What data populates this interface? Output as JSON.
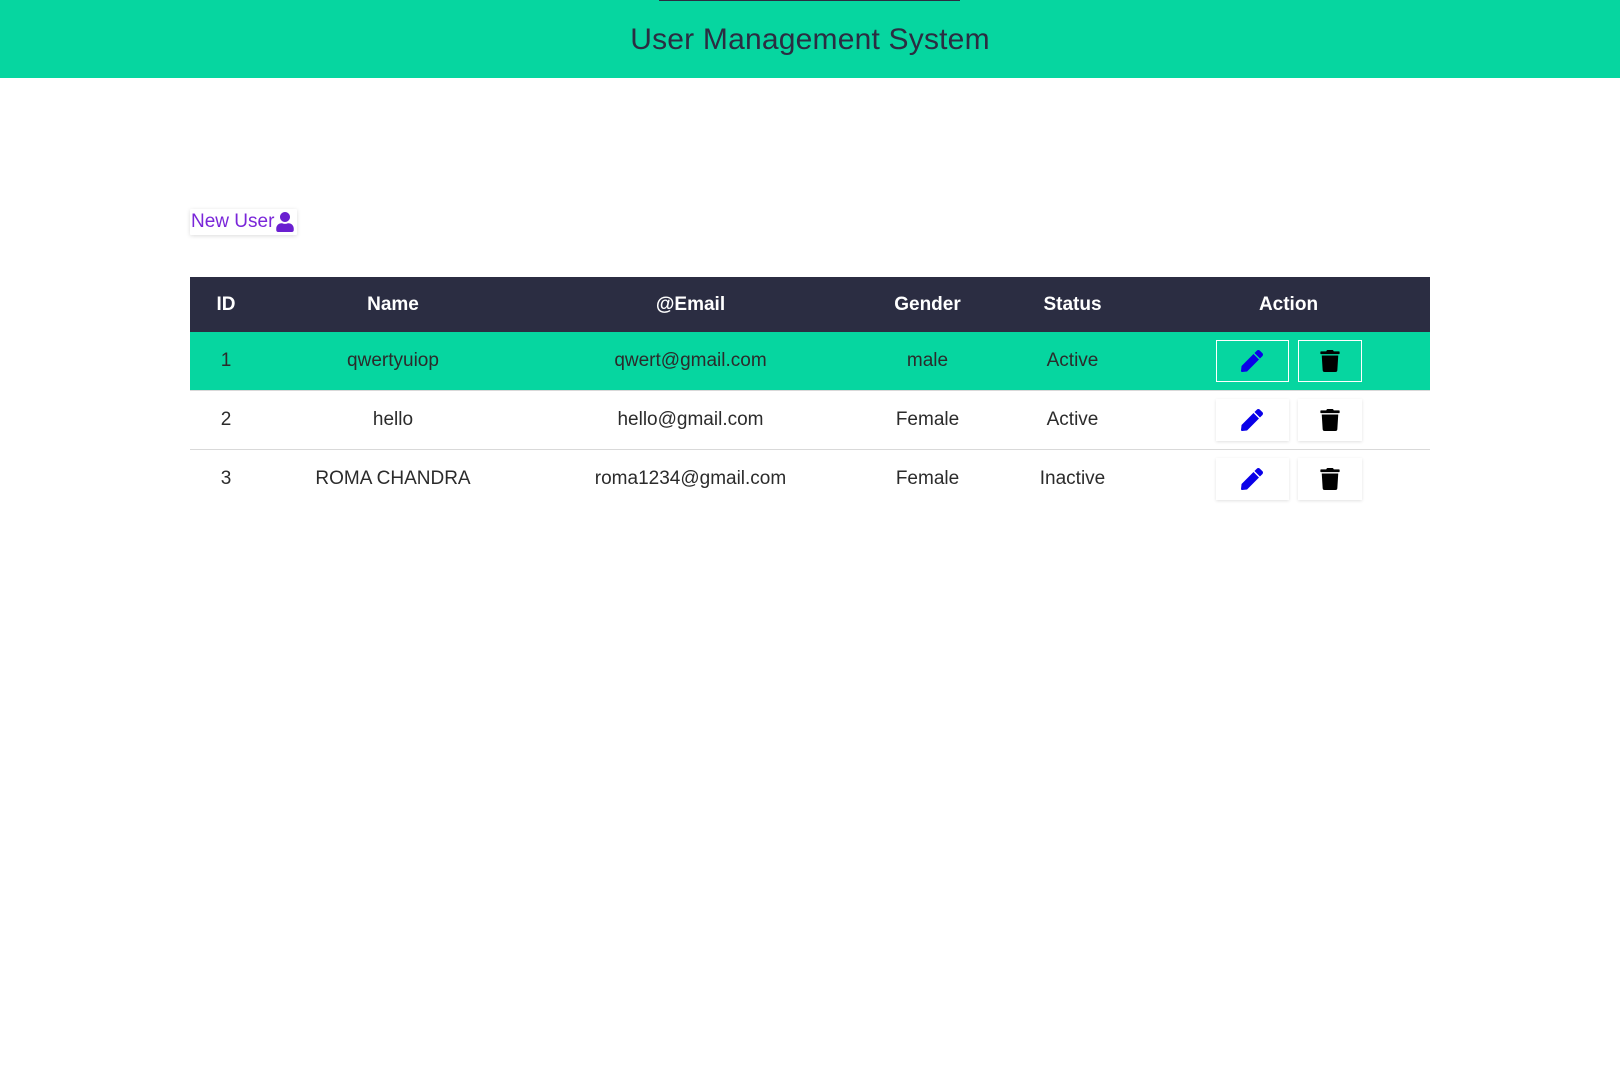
{
  "header": {
    "title": "User Management System"
  },
  "toolbar": {
    "new_user_label": "New User",
    "new_user_icon": "user-icon"
  },
  "table": {
    "columns": [
      "ID",
      "Name",
      "@Email",
      "Gender",
      "Status",
      "Action"
    ],
    "rows": [
      {
        "id": "1",
        "name": "qwertyuiop",
        "email": "qwert@gmail.com",
        "gender": "male",
        "status": "Active",
        "highlighted": true
      },
      {
        "id": "2",
        "name": "hello",
        "email": "hello@gmail.com",
        "gender": "Female",
        "status": "Active",
        "highlighted": false
      },
      {
        "id": "3",
        "name": "ROMA CHANDRA",
        "email": "roma1234@gmail.com",
        "gender": "Female",
        "status": "Inactive",
        "highlighted": false
      }
    ],
    "action_icons": {
      "edit": "pencil-icon",
      "delete": "trash-icon"
    }
  },
  "colors": {
    "accent": "#06d6a0",
    "header_dark": "#2b2d42",
    "new_user_text": "#7a26d9",
    "edit_icon": "#0a00e8",
    "delete_icon": "#000000"
  }
}
